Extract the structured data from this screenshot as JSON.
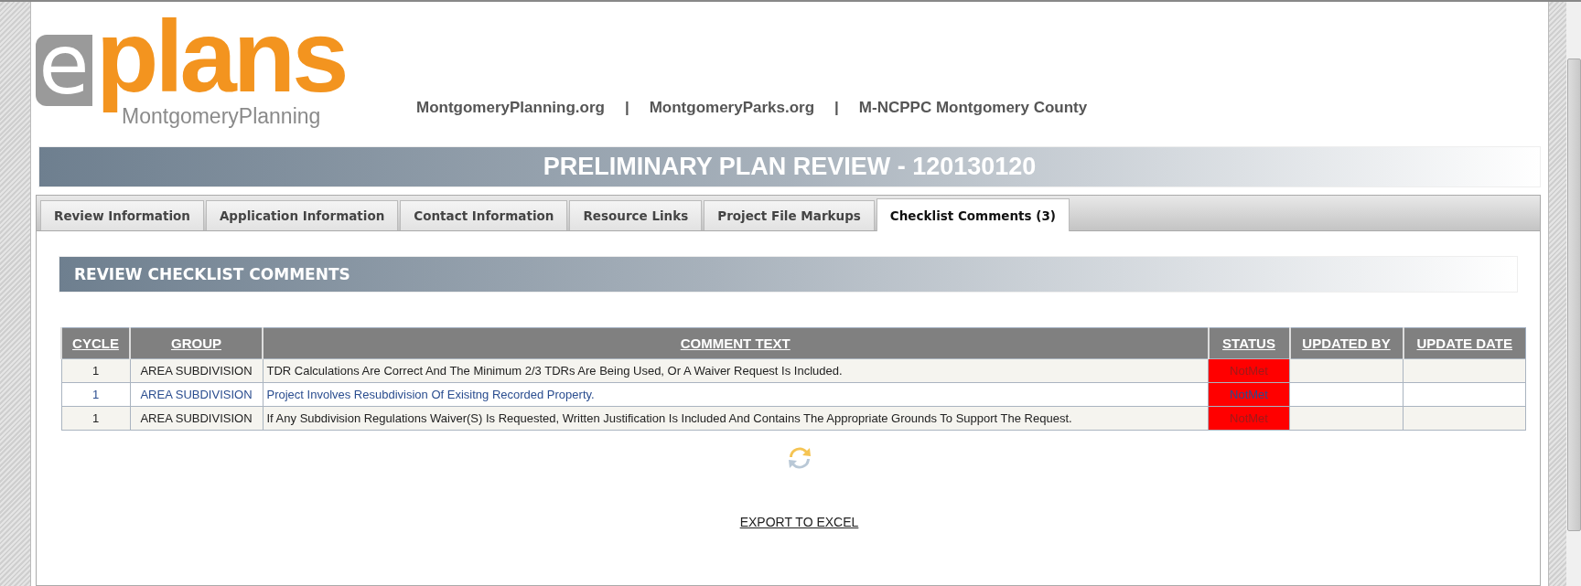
{
  "logo": {
    "mark": "e",
    "word": "plans",
    "subtitle": "MontgomeryPlanning"
  },
  "header_links": [
    {
      "label": "MontgomeryPlanning.org"
    },
    {
      "label": "MontgomeryParks.org"
    },
    {
      "label": "M-NCPPC Montgomery County"
    }
  ],
  "link_separator": "|",
  "page_title": "PRELIMINARY PLAN REVIEW - 120130120",
  "tabs": [
    {
      "label": "Review Information",
      "selected": false
    },
    {
      "label": "Application Information",
      "selected": false
    },
    {
      "label": "Contact Information",
      "selected": false
    },
    {
      "label": "Resource Links",
      "selected": false
    },
    {
      "label": "Project File Markups",
      "selected": false
    },
    {
      "label": "Checklist Comments (3)",
      "selected": true
    }
  ],
  "section_title": "REVIEW CHECKLIST COMMENTS",
  "table": {
    "columns": [
      "CYCLE",
      "GROUP",
      "COMMENT TEXT",
      "STATUS",
      "UPDATED BY",
      "UPDATE DATE"
    ],
    "rows": [
      {
        "cycle": "1",
        "group": "AREA SUBDIVISION",
        "comment": "TDR Calculations Are Correct And The Minimum 2/3 TDRs Are Being Used, Or A Waiver Request Is Included.",
        "status": "NotMet",
        "color": "#ff0000",
        "selected": false
      },
      {
        "cycle": "1",
        "group": "AREA SUBDIVISION",
        "comment": "Project Involves Resubdivision Of Exisitng Recorded Property.",
        "status": "NotMet",
        "color": "#ff0000",
        "selected": true
      },
      {
        "cycle": "1",
        "group": "AREA SUBDIVISION",
        "comment": "If Any Subdivision Regulations Waiver(S) Is Requested, Written Justification Is Included And Contains The Appropriate Grounds To Support The Request.",
        "status": "NotMet",
        "color": "#ff0000",
        "selected": false
      }
    ]
  },
  "export_link": "EXPORT TO EXCEL"
}
